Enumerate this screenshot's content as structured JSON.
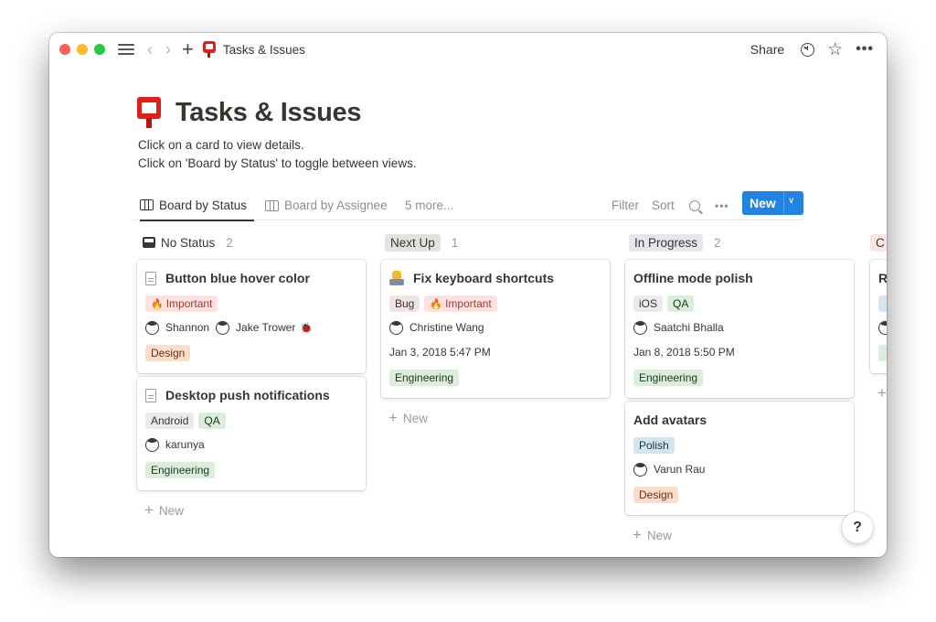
{
  "window": {
    "breadcrumb_title": "Tasks & Issues",
    "share_label": "Share",
    "icons": {
      "sidebar_toggle": "hamburger-icon",
      "back": "chevron-left-icon",
      "forward": "chevron-right-icon",
      "add": "plus-icon",
      "page": "postbox-emoji",
      "updates": "clock-icon",
      "favorite": "star-icon",
      "more": "more-icon"
    }
  },
  "page": {
    "title": "Tasks & Issues",
    "description": [
      "Click on a card to view details.",
      "Click on 'Board by Status' to toggle between views."
    ]
  },
  "views": {
    "tabs": [
      {
        "label": "Board by Status",
        "active": true
      },
      {
        "label": "Board by Assignee",
        "active": false
      }
    ],
    "more_label": "5 more...",
    "filter_label": "Filter",
    "sort_label": "Sort",
    "new_label": "New"
  },
  "colors": {
    "accent": "#2383e2",
    "tag_important_bg": "#fde2e0",
    "tag_important_fg": "#9f3a2f",
    "tag_design_bg": "#fadec9",
    "tag_design_fg": "#6b2e1a",
    "tag_engineering_bg": "#dbeddb",
    "tag_engineering_fg": "#1c3829",
    "tag_qa_bg": "#dbeddb",
    "tag_gray_bg": "#ebebea",
    "tag_bug_bg": "#f1e3e4",
    "tag_polish_bg": "#d3e5ef",
    "status_nextup_bg": "#e3e2e0",
    "status_inprogress_bg": "#e8e5ec",
    "status_partial_bg": "#fbe4e4"
  },
  "columns": [
    {
      "label": "No Status",
      "count": "2",
      "cards": [
        {
          "title": "Button blue hover color",
          "tags": [
            {
              "label": "Important",
              "icon": "fire-emoji"
            }
          ],
          "people": [
            "Shannon",
            "Jake Trower"
          ],
          "extra_icon": "bug-emoji",
          "team": "Design"
        },
        {
          "title": "Desktop push notifications",
          "tags": [
            {
              "label": "Android"
            },
            {
              "label": "QA"
            }
          ],
          "people": [
            "karunya"
          ],
          "team": "Engineering"
        }
      ],
      "new_label": "New"
    },
    {
      "label": "Next Up",
      "count": "1",
      "cards": [
        {
          "title": "Fix keyboard shortcuts",
          "tags": [
            {
              "label": "Bug"
            },
            {
              "label": "Important",
              "icon": "fire-emoji"
            }
          ],
          "people": [
            "Christine Wang"
          ],
          "date": "Jan 3, 2018 5:47 PM",
          "team": "Engineering"
        }
      ],
      "new_label": "New"
    },
    {
      "label": "In Progress",
      "count": "2",
      "cards": [
        {
          "title": "Offline mode polish",
          "tags": [
            {
              "label": "iOS"
            },
            {
              "label": "QA"
            }
          ],
          "people": [
            "Saatchi Bhalla"
          ],
          "date": "Jan 8, 2018 5:50 PM",
          "team": "Engineering"
        },
        {
          "title": "Add avatars",
          "tags": [
            {
              "label": "Polish"
            }
          ],
          "people": [
            "Varun Rau"
          ],
          "team": "Design"
        }
      ],
      "new_label": "New"
    },
    {
      "label": "C",
      "partial_card_title": "Re"
    }
  ],
  "help_label": "?"
}
